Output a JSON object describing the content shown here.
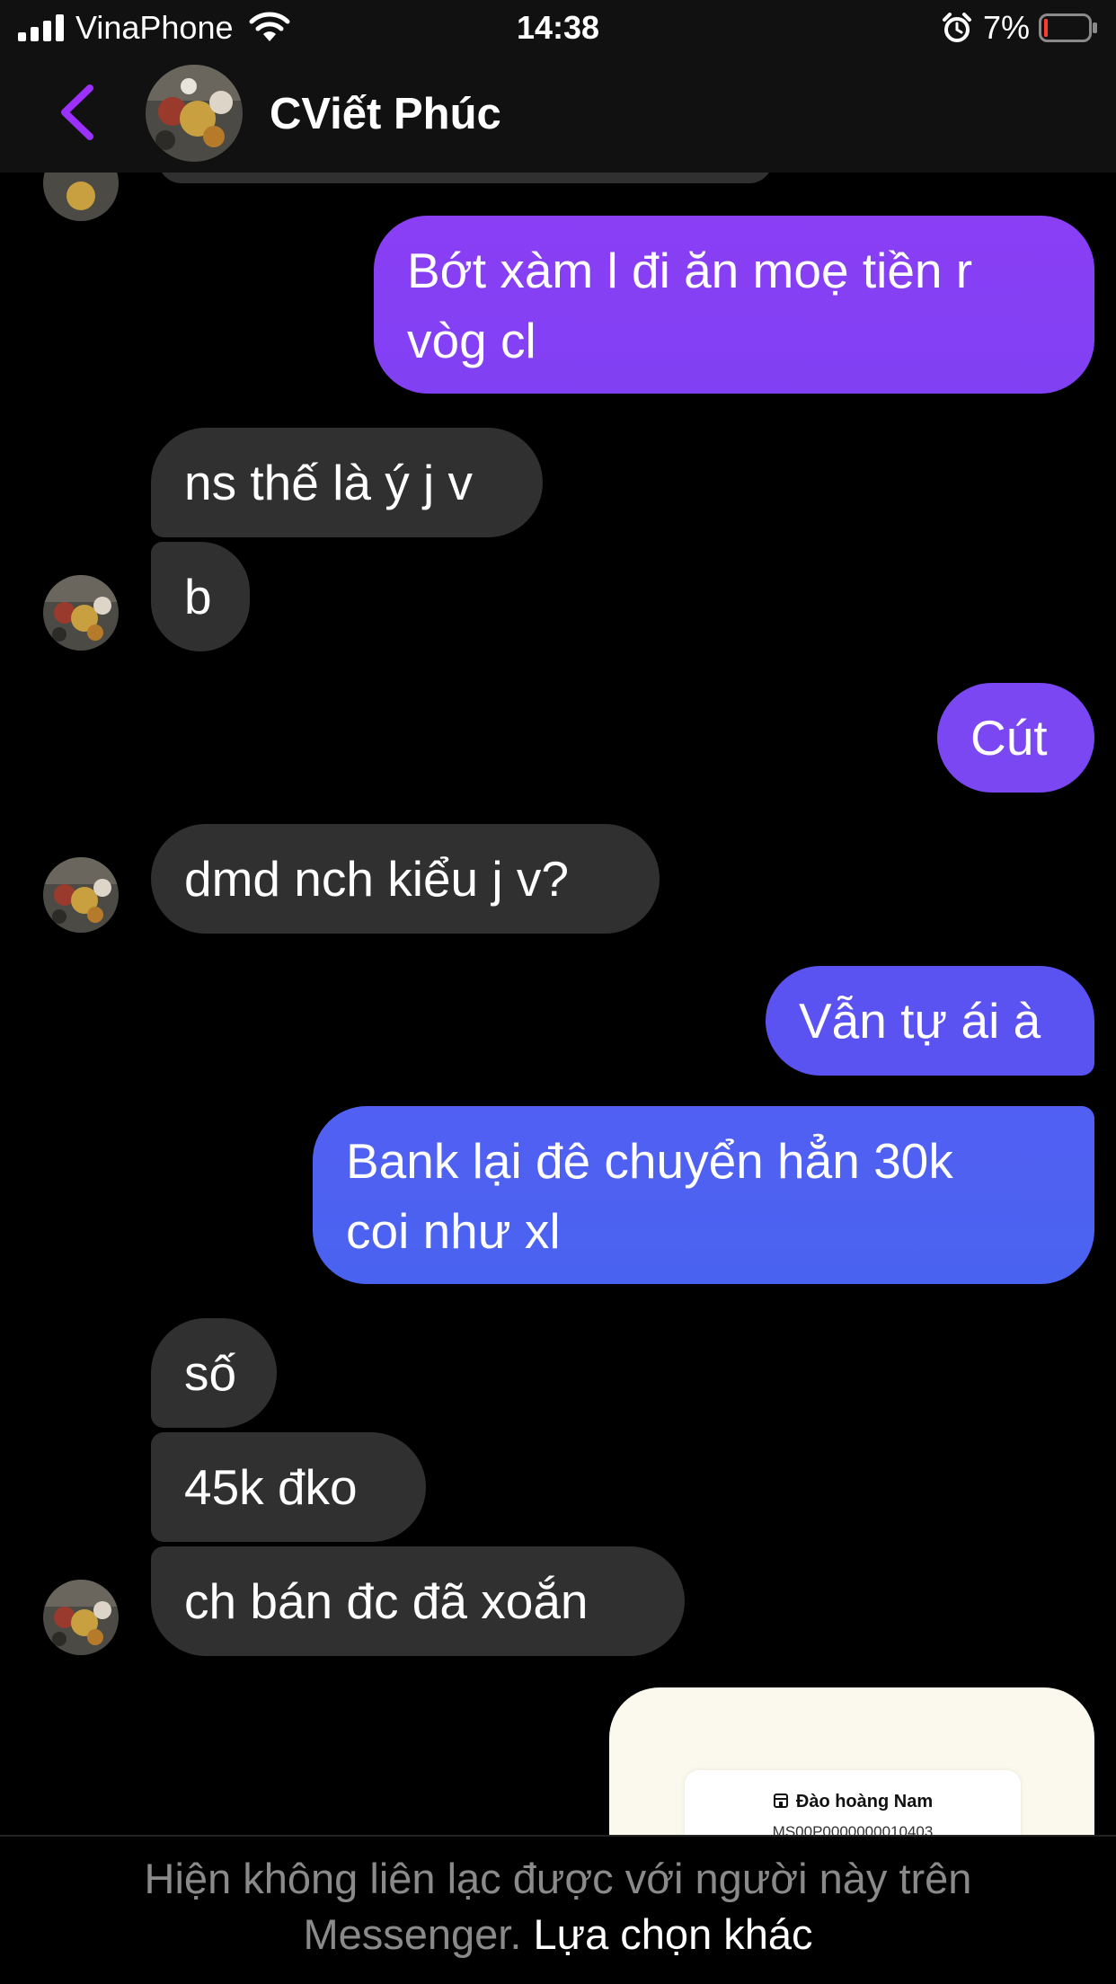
{
  "status_bar": {
    "carrier": "VinaPhone",
    "time": "14:38",
    "battery_percent": "7%",
    "battery_level": 0.07,
    "icons": [
      "signal-icon",
      "wifi-icon",
      "alarm-icon",
      "battery-icon"
    ]
  },
  "header": {
    "title": "CViết Phúc",
    "back_icon": "chevron-left-icon",
    "accent_color": "#9b30ff"
  },
  "messages": [
    {
      "side": "sent",
      "lines": [
        "Bớt xàm l đi ăn moẹ tiền r",
        "vòg cl"
      ]
    },
    {
      "side": "received",
      "text": "ns thế là ý j v"
    },
    {
      "side": "received",
      "text": "b"
    },
    {
      "side": "sent",
      "text": "Cút"
    },
    {
      "side": "received",
      "text": "dmd nch kiểu j v?"
    },
    {
      "side": "sent",
      "text": "Vẫn tự ái à"
    },
    {
      "side": "sent",
      "lines": [
        "Bank lại đê chuyển hẳn 30k",
        "coi như xl"
      ]
    },
    {
      "side": "received",
      "text": "số"
    },
    {
      "side": "received",
      "text": "45k đko"
    },
    {
      "side": "received",
      "text": "ch bán đc đã xoắn"
    }
  ],
  "receipt": {
    "name": "Đào hoàng Nam",
    "code": "MS00P0000000010403"
  },
  "footer": {
    "line1": "Hiện không liên lạc được với người này trên",
    "line2_prefix": "Messenger.",
    "link": "Lựa chọn khác"
  },
  "colors": {
    "background": "#000000",
    "received_bubble": "#303030",
    "sent_bubble_purple": "#8a3ff5",
    "sent_bubble_blue": "#4e5ef2"
  }
}
